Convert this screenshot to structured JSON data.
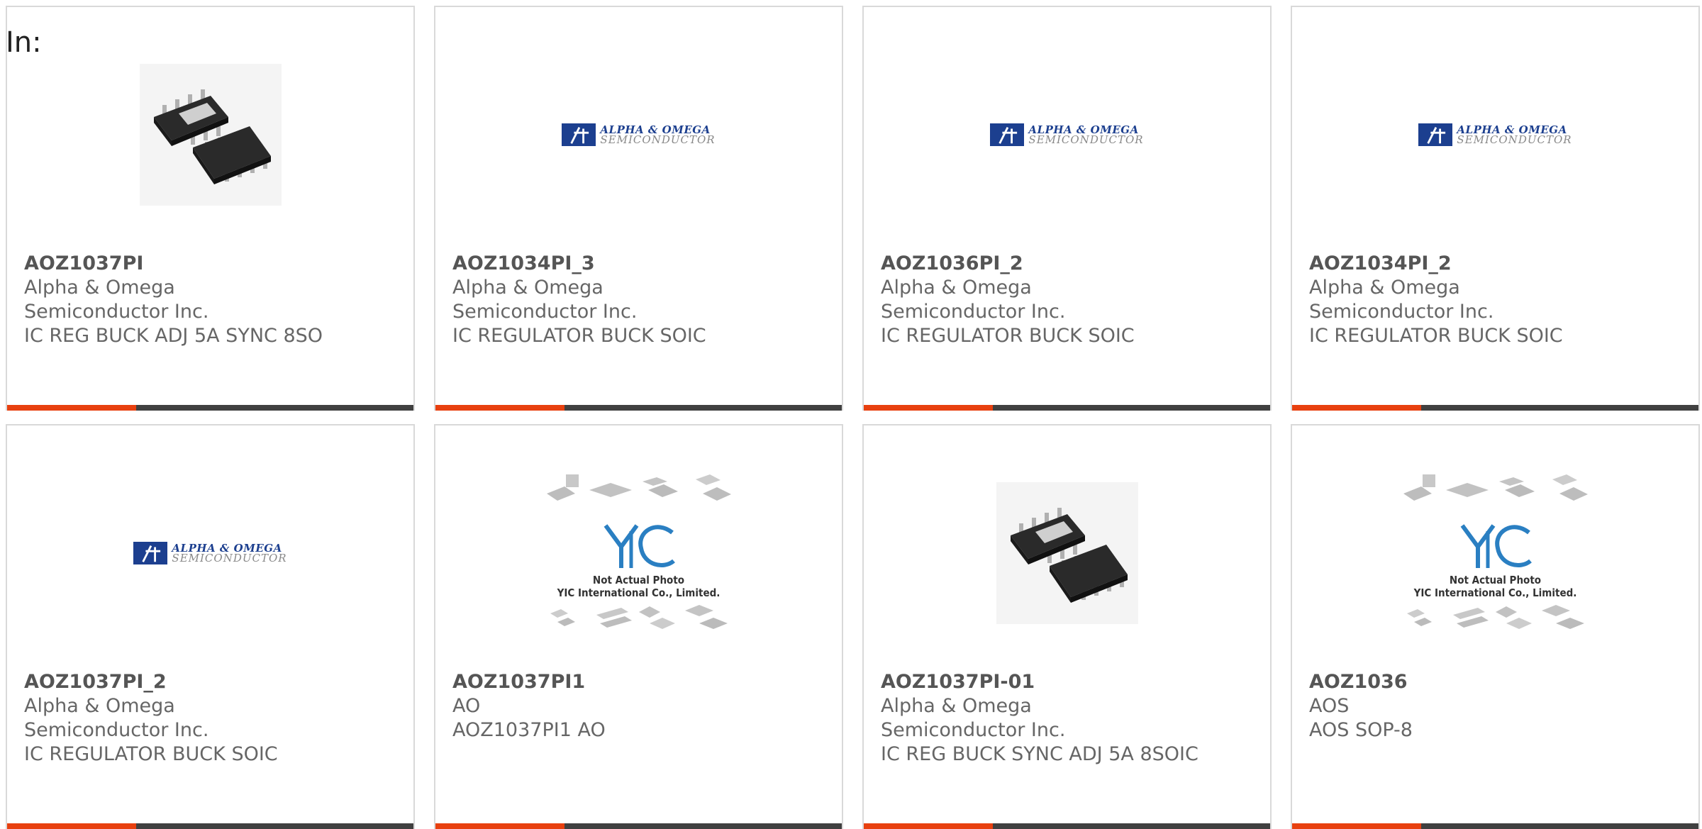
{
  "header": {
    "in_label": "In:"
  },
  "colors": {
    "accent": "#e8400f",
    "bar": "#404040",
    "border": "#d9d9d9",
    "logo_blue": "#1c3f8f"
  },
  "logos": {
    "aos_line1": "ALPHA & OMEGA",
    "aos_line2": "SEMICONDUCTOR",
    "yic_line1": "Not Actual Photo",
    "yic_line2": "YIC International Co., Limited."
  },
  "products": [
    {
      "part": "AOZ1037PI",
      "mfr": "Alpha & Omega Semiconductor Inc.",
      "desc": "IC REG BUCK ADJ 5A SYNC 8SO",
      "image": "chip-photo"
    },
    {
      "part": "AOZ1034PI_3",
      "mfr": "Alpha & Omega Semiconductor Inc.",
      "desc": "IC REGULATOR BUCK SOIC",
      "image": "aos-logo"
    },
    {
      "part": "AOZ1036PI_2",
      "mfr": "Alpha & Omega Semiconductor Inc.",
      "desc": "IC REGULATOR BUCK SOIC",
      "image": "aos-logo"
    },
    {
      "part": "AOZ1034PI_2",
      "mfr": "Alpha & Omega Semiconductor Inc.",
      "desc": "IC REGULATOR BUCK SOIC",
      "image": "aos-logo"
    },
    {
      "part": "AOZ1037PI_2",
      "mfr": "Alpha & Omega Semiconductor Inc.",
      "desc": "IC REGULATOR BUCK SOIC",
      "image": "aos-logo"
    },
    {
      "part": "AOZ1037PI1",
      "mfr": "AO",
      "desc": "AOZ1037PI1 AO",
      "image": "yic-placeholder"
    },
    {
      "part": "AOZ1037PI-01",
      "mfr": "Alpha & Omega Semiconductor Inc.",
      "desc": "IC REG BUCK SYNC ADJ 5A 8SOIC",
      "image": "chip-photo"
    },
    {
      "part": "AOZ1036",
      "mfr": "AOS",
      "desc": "AOS SOP-8",
      "image": "yic-placeholder"
    }
  ]
}
